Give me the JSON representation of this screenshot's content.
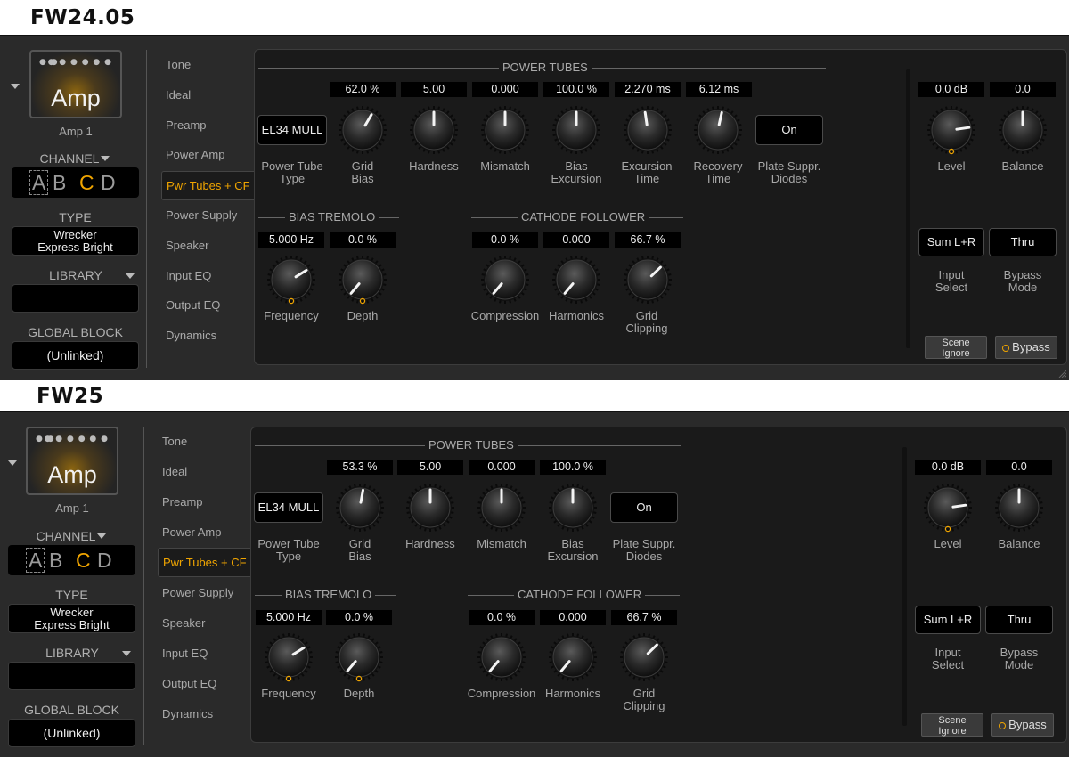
{
  "panels": [
    {
      "title": "FW24.05",
      "block": {
        "name": "Amp",
        "instance": "Amp 1"
      },
      "channel": {
        "label": "CHANNEL",
        "options": [
          "A",
          "B",
          "C",
          "D"
        ],
        "selected": "C"
      },
      "type": {
        "label": "TYPE",
        "value": "Wrecker Express Bright"
      },
      "library": {
        "label": "LIBRARY",
        "value": ""
      },
      "global_block": {
        "label": "GLOBAL BLOCK",
        "value": "(Unlinked)"
      },
      "nav": [
        "Tone",
        "Ideal",
        "Preamp",
        "Power Amp",
        "Pwr Tubes + CF",
        "Power Supply",
        "Speaker",
        "Input EQ",
        "Output EQ",
        "Dynamics"
      ],
      "nav_selected": "Pwr Tubes + CF",
      "power_tubes": {
        "title": "POWER TUBES",
        "tube_type": {
          "value": "EL34 MULL",
          "label1": "Power Tube",
          "label2": "Type"
        },
        "knobs": [
          {
            "value": "62.0 %",
            "label1": "Grid",
            "label2": "Bias",
            "angle": 30
          },
          {
            "value": "5.00",
            "label1": "Hardness",
            "label2": "",
            "angle": 0
          },
          {
            "value": "0.000",
            "label1": "Mismatch",
            "label2": "",
            "angle": 0
          },
          {
            "value": "100.0 %",
            "label1": "Bias",
            "label2": "Excursion",
            "angle": 0
          },
          {
            "value": "2.270 ms",
            "label1": "Excursion",
            "label2": "Time",
            "angle": -8
          },
          {
            "value": "6.12 ms",
            "label1": "Recovery",
            "label2": "Time",
            "angle": 12
          }
        ],
        "plate": {
          "value": "On",
          "label1": "Plate Suppr.",
          "label2": "Diodes"
        }
      },
      "bias_tremolo": {
        "title": "BIAS TREMOLO",
        "knobs": [
          {
            "value": "5.000 Hz",
            "label1": "Frequency",
            "label2": "",
            "angle": 58
          },
          {
            "value": "0.0 %",
            "label1": "Depth",
            "label2": "",
            "angle": -140
          }
        ]
      },
      "cathode_follower": {
        "title": "CATHODE FOLLOWER",
        "knobs": [
          {
            "value": "0.0 %",
            "label1": "Compression",
            "label2": "",
            "angle": -140
          },
          {
            "value": "0.000",
            "label1": "Harmonics",
            "label2": "",
            "angle": -140
          },
          {
            "value": "66.7 %",
            "label1": "Grid",
            "label2": "Clipping",
            "angle": 46
          }
        ]
      },
      "output": {
        "level": {
          "value": "0.0 dB",
          "label": "Level",
          "angle": 82
        },
        "balance": {
          "value": "0.0",
          "label": "Balance",
          "angle": 0
        },
        "input_select": {
          "value": "Sum L+R",
          "label1": "Input",
          "label2": "Select"
        },
        "bypass_mode": {
          "value": "Thru",
          "label1": "Bypass",
          "label2": "Mode"
        },
        "scene_ignore": {
          "line1": "Scene",
          "line2": "Ignore"
        },
        "bypass": "Bypass"
      }
    },
    {
      "title": "FW25",
      "block": {
        "name": "Amp",
        "instance": "Amp 1"
      },
      "channel": {
        "label": "CHANNEL",
        "options": [
          "A",
          "B",
          "C",
          "D"
        ],
        "selected": "C"
      },
      "type": {
        "label": "TYPE",
        "value": "Wrecker Express Bright"
      },
      "library": {
        "label": "LIBRARY",
        "value": ""
      },
      "global_block": {
        "label": "GLOBAL BLOCK",
        "value": "(Unlinked)"
      },
      "nav": [
        "Tone",
        "Ideal",
        "Preamp",
        "Power Amp",
        "Pwr Tubes + CF",
        "Power Supply",
        "Speaker",
        "Input EQ",
        "Output EQ",
        "Dynamics"
      ],
      "nav_selected": "Pwr Tubes + CF",
      "power_tubes": {
        "title": "POWER TUBES",
        "tube_type": {
          "value": "EL34 MULL",
          "label1": "Power Tube",
          "label2": "Type"
        },
        "knobs": [
          {
            "value": "53.3 %",
            "label1": "Grid",
            "label2": "Bias",
            "angle": 10
          },
          {
            "value": "5.00",
            "label1": "Hardness",
            "label2": "",
            "angle": 0
          },
          {
            "value": "0.000",
            "label1": "Mismatch",
            "label2": "",
            "angle": 0
          },
          {
            "value": "100.0 %",
            "label1": "Bias",
            "label2": "Excursion",
            "angle": 0
          }
        ],
        "plate": {
          "value": "On",
          "label1": "Plate Suppr.",
          "label2": "Diodes"
        }
      },
      "bias_tremolo": {
        "title": "BIAS TREMOLO",
        "knobs": [
          {
            "value": "5.000 Hz",
            "label1": "Frequency",
            "label2": "",
            "angle": 58
          },
          {
            "value": "0.0 %",
            "label1": "Depth",
            "label2": "",
            "angle": -140
          }
        ]
      },
      "cathode_follower": {
        "title": "CATHODE FOLLOWER",
        "knobs": [
          {
            "value": "0.0 %",
            "label1": "Compression",
            "label2": "",
            "angle": -140
          },
          {
            "value": "0.000",
            "label1": "Harmonics",
            "label2": "",
            "angle": -140
          },
          {
            "value": "66.7 %",
            "label1": "Grid",
            "label2": "Clipping",
            "angle": 46
          }
        ]
      },
      "output": {
        "level": {
          "value": "0.0 dB",
          "label": "Level",
          "angle": 82
        },
        "balance": {
          "value": "0.0",
          "label": "Balance",
          "angle": 0
        },
        "input_select": {
          "value": "Sum L+R",
          "label1": "Input",
          "label2": "Select"
        },
        "bypass_mode": {
          "value": "Thru",
          "label1": "Bypass",
          "label2": "Mode"
        },
        "scene_ignore": {
          "line1": "Scene",
          "line2": "Ignore"
        },
        "bypass": "Bypass"
      }
    }
  ],
  "colors": {
    "accent": "#f0a500",
    "panel_bg": "#2a2a2a",
    "main_bg": "#1a1a1a"
  }
}
